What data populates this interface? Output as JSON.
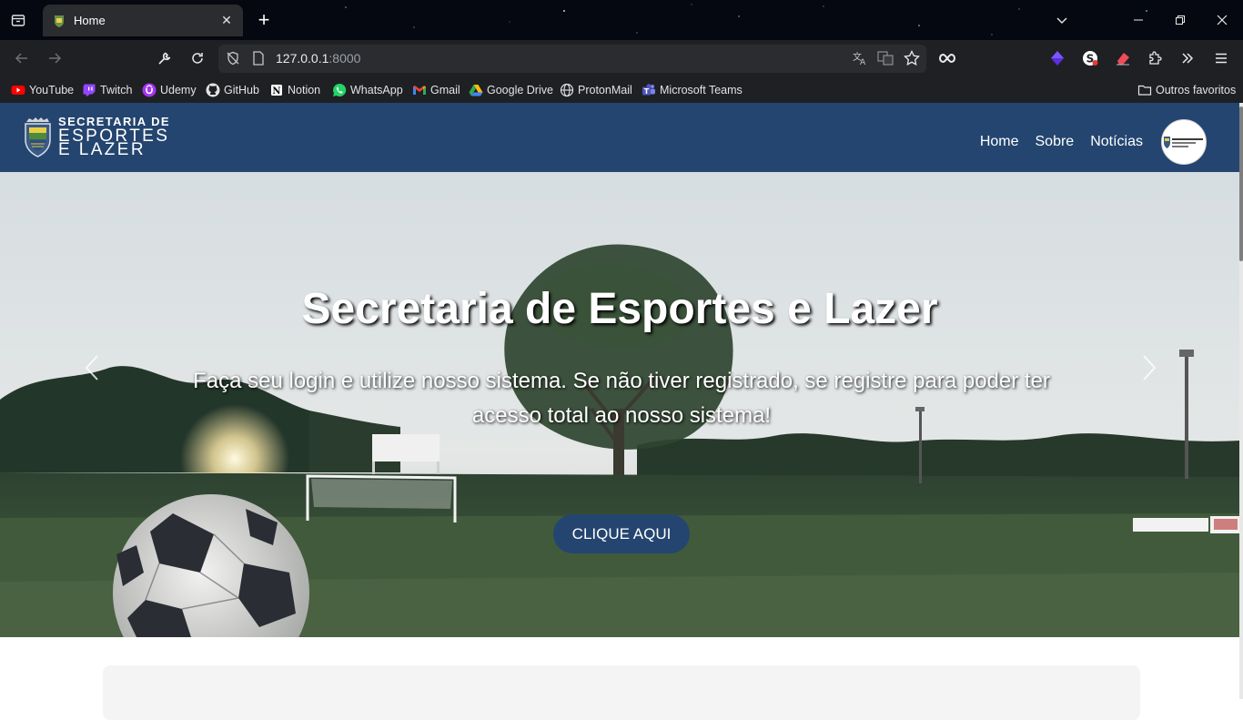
{
  "browser": {
    "tab_title": "Home",
    "url_host": "127.0.0.1",
    "url_port": ":8000",
    "bookmarks": [
      {
        "label": "YouTube",
        "icon": "youtube-icon",
        "color": "#ff0000"
      },
      {
        "label": "Twitch",
        "icon": "twitch-icon",
        "color": "#9146ff"
      },
      {
        "label": "Udemy",
        "icon": "udemy-icon",
        "color": "#a435f0"
      },
      {
        "label": "GitHub",
        "icon": "github-icon",
        "color": "#e3e3e3"
      },
      {
        "label": "Notion",
        "icon": "notion-icon",
        "color": "#e3e3e3"
      },
      {
        "label": "WhatsApp",
        "icon": "whatsapp-icon",
        "color": "#25d366"
      },
      {
        "label": "Gmail",
        "icon": "gmail-icon",
        "color": "#ea4335"
      },
      {
        "label": "Google Drive",
        "icon": "google-drive-icon",
        "color": "#fbbc04"
      },
      {
        "label": "ProtonMail",
        "icon": "globe-icon",
        "color": "#e3e3e3"
      },
      {
        "label": "Microsoft Teams",
        "icon": "teams-icon",
        "color": "#6264a7"
      }
    ],
    "other_bookmarks": "Outros favoritos"
  },
  "site": {
    "logo": {
      "line1": "SECRETARIA DE",
      "line2": "ESPORTES",
      "line3": "E LAZER"
    },
    "nav": {
      "home": "Home",
      "about": "Sobre",
      "news": "Notícias"
    },
    "brand_color": "#24456f"
  },
  "hero": {
    "title": "Secretaria de Esportes e Lazer",
    "subtitle": "Faça seu login e utilize nosso sistema. Se não tiver registrado, se registre para poder ter acesso total ao nosso sistema!",
    "button": "CLIQUE AQUI"
  }
}
